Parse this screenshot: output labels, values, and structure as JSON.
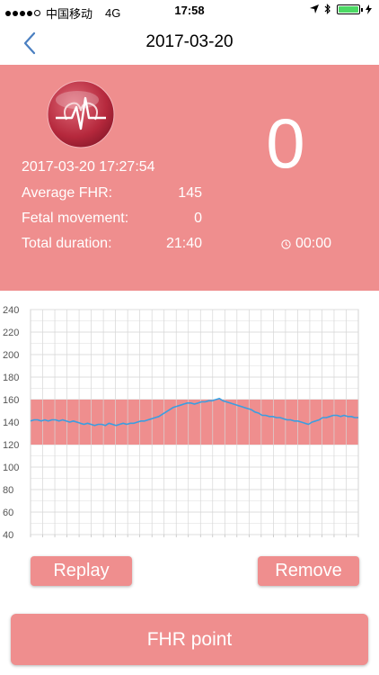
{
  "status_bar": {
    "carrier": "中国移动",
    "network": "4G",
    "time": "17:58"
  },
  "header": {
    "title": "2017-03-20",
    "back_icon": "chevron-left-icon"
  },
  "summary": {
    "datetime": "2017-03-20 17:27:54",
    "count": "0",
    "rows": [
      {
        "label": "Average FHR:",
        "value": "145"
      },
      {
        "label": "Fetal movement:",
        "value": "0"
      },
      {
        "label": "Total duration:",
        "value": "21:40"
      }
    ],
    "timer": "00:00",
    "timer_icon": "clock-icon",
    "logo_icon": "heartbeat-logo-icon"
  },
  "colors": {
    "accent": "#ef8e8e",
    "band": "#ef8e8e",
    "line": "#3b9ee0",
    "grid": "#dddddd"
  },
  "chart_data": {
    "type": "line",
    "title": "",
    "xlabel": "",
    "ylabel": "",
    "ylim": [
      40,
      240
    ],
    "yticks": [
      "240",
      "220",
      "200",
      "180",
      "160",
      "140",
      "120",
      "100",
      "80",
      "60",
      "40"
    ],
    "normal_band": [
      120,
      160
    ],
    "grid": true,
    "series": [
      {
        "values": [
          141,
          142,
          142,
          141,
          142,
          141,
          142,
          142,
          141,
          142,
          141,
          140,
          141,
          140,
          139,
          138,
          139,
          138,
          137,
          138,
          138,
          137,
          139,
          138,
          137,
          138,
          139,
          138,
          139,
          139,
          140,
          141,
          141,
          142,
          143,
          144,
          145,
          147,
          149,
          151,
          153,
          154,
          155,
          156,
          157,
          157,
          156,
          157,
          158,
          158,
          159,
          159,
          160,
          161,
          159,
          158,
          157,
          156,
          155,
          154,
          153,
          152,
          151,
          149,
          148,
          146,
          146,
          145,
          145,
          144,
          144,
          143,
          142,
          142,
          141,
          141,
          140,
          139,
          138,
          140,
          141,
          142,
          144,
          144,
          145,
          146,
          146,
          145,
          146,
          145,
          145,
          144,
          144
        ]
      }
    ]
  },
  "buttons": {
    "replay": "Replay",
    "remove": "Remove",
    "fhr_point": "FHR point"
  }
}
